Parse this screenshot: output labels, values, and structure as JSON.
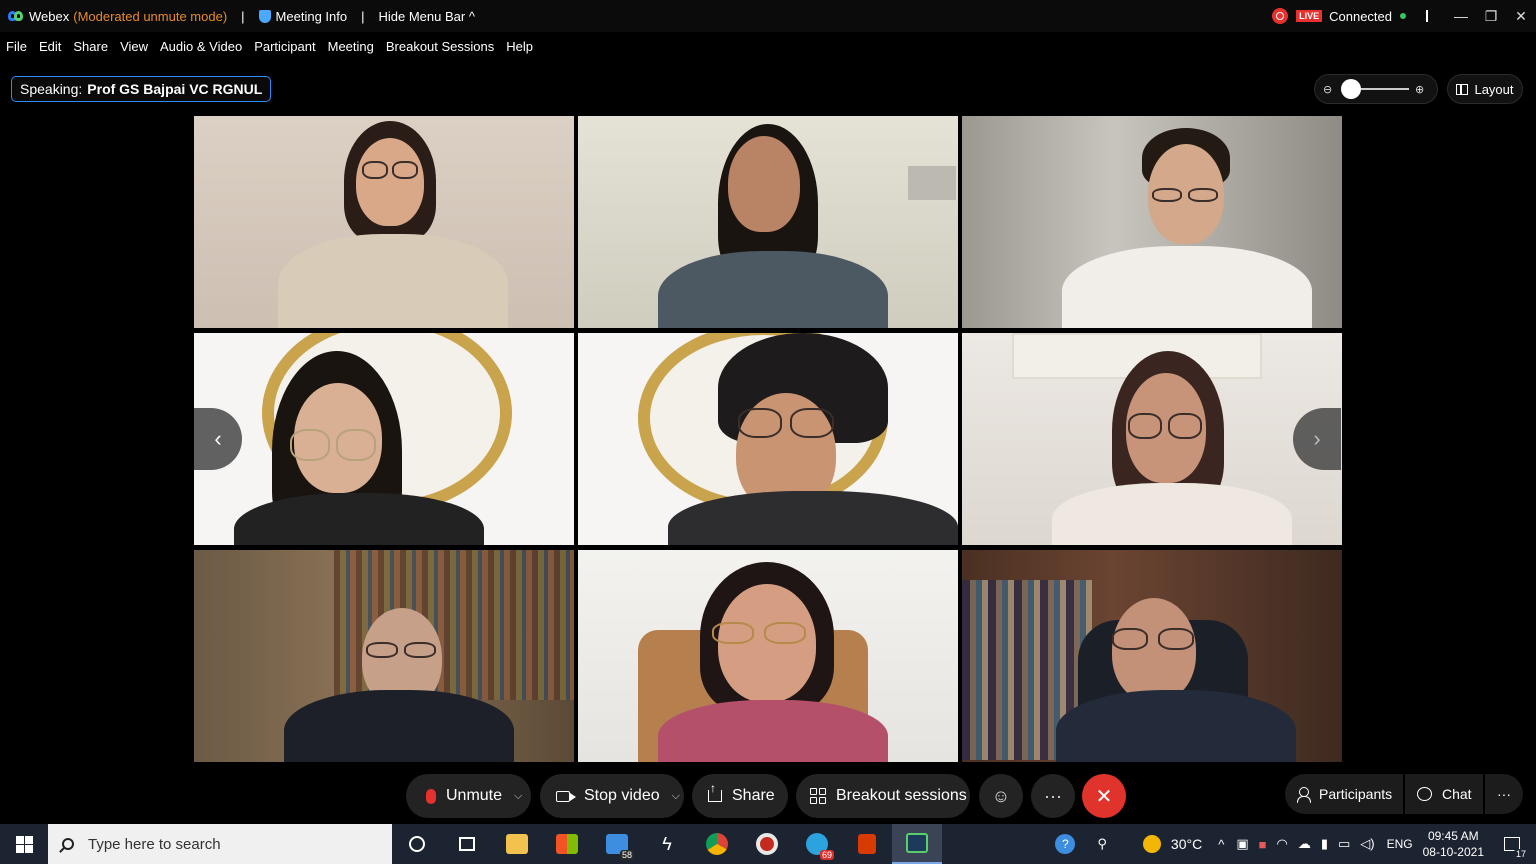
{
  "titlebar": {
    "app": "Webex",
    "mode": "(Moderated unmute mode)",
    "separator": "|",
    "meeting_info": "Meeting Info",
    "hide_menu": "Hide Menu Bar",
    "live": "LIVE",
    "status": "Connected",
    "minimize": "—",
    "restore": "❐",
    "close": "✕"
  },
  "menu": [
    "File",
    "Edit",
    "Share",
    "View",
    "Audio & Video",
    "Participant",
    "Meeting",
    "Breakout Sessions",
    "Help"
  ],
  "speaking": {
    "label": "Speaking:",
    "name": "Prof GS Bajpai VC RGNUL"
  },
  "view": {
    "layout_label": "Layout",
    "zoom_level_fraction": 0.0
  },
  "controls": {
    "unmute": "Unmute",
    "stop_video": "Stop video",
    "share": "Share",
    "breakout": "Breakout sessions",
    "participants": "Participants",
    "chat": "Chat",
    "more": "···"
  },
  "taskbar": {
    "search_placeholder": "Type here to search",
    "mail_badge": "58",
    "telegram_badge": "69",
    "temperature": "30°C",
    "language": "ENG",
    "time": "09:45 AM",
    "date": "08-10-2021",
    "notification_count": "17"
  },
  "colors": {
    "accent_blue": "#2a8cff",
    "end_red": "#e0332c",
    "mode_orange": "#e88a2d",
    "connected_green": "#3ec45a"
  }
}
